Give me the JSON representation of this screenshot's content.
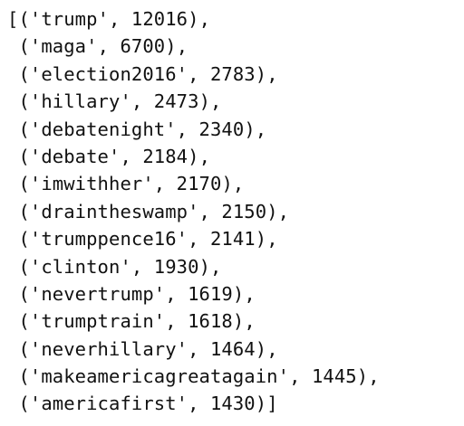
{
  "output": {
    "open_bracket": "[",
    "close_bracket": "]",
    "items": [
      {
        "tag": "trump",
        "count": "12016"
      },
      {
        "tag": "maga",
        "count": "6700"
      },
      {
        "tag": "election2016",
        "count": "2783"
      },
      {
        "tag": "hillary",
        "count": "2473"
      },
      {
        "tag": "debatenight",
        "count": "2340"
      },
      {
        "tag": "debate",
        "count": "2184"
      },
      {
        "tag": "imwithher",
        "count": "2170"
      },
      {
        "tag": "draintheswamp",
        "count": "2150"
      },
      {
        "tag": "trumppence16",
        "count": "2141"
      },
      {
        "tag": "clinton",
        "count": "1930"
      },
      {
        "tag": "nevertrump",
        "count": "1619"
      },
      {
        "tag": "trumptrain",
        "count": "1618"
      },
      {
        "tag": "neverhillary",
        "count": "1464"
      },
      {
        "tag": "makeamericagreatagain",
        "count": "1445"
      },
      {
        "tag": "americafirst",
        "count": "1430"
      }
    ]
  }
}
